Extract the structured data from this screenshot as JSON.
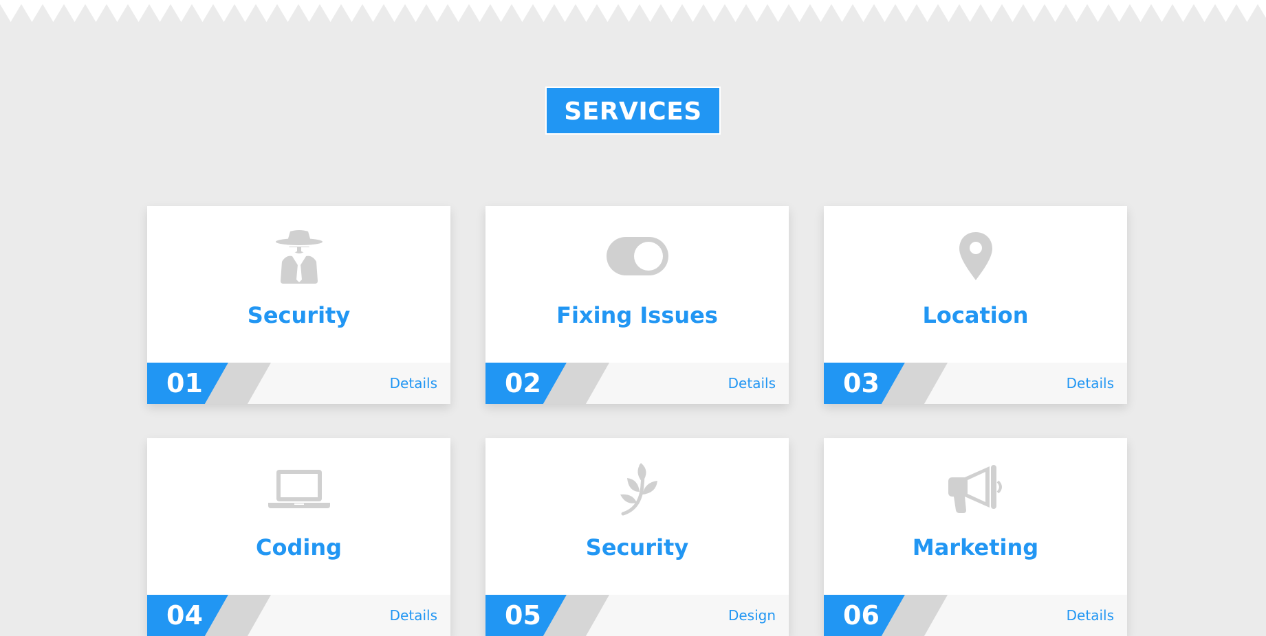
{
  "section": {
    "title": "SERVICES"
  },
  "colors": {
    "accent": "#2196f3",
    "background": "#ebebeb",
    "icon": "#d0d0d0",
    "stripe": "#d6d6d6",
    "footer": "#f7f7f7"
  },
  "services": [
    {
      "number": "01",
      "name": "Security",
      "link_label": "Details",
      "icon": "spy-icon"
    },
    {
      "number": "02",
      "name": "Fixing Issues",
      "link_label": "Details",
      "icon": "toggle-icon"
    },
    {
      "number": "03",
      "name": "Location",
      "link_label": "Details",
      "icon": "map-pin-icon"
    },
    {
      "number": "04",
      "name": "Coding",
      "link_label": "Details",
      "icon": "laptop-icon"
    },
    {
      "number": "05",
      "name": "Security",
      "link_label": "Design",
      "icon": "leaf-icon"
    },
    {
      "number": "06",
      "name": "Marketing",
      "link_label": "Details",
      "icon": "megaphone-icon"
    }
  ]
}
